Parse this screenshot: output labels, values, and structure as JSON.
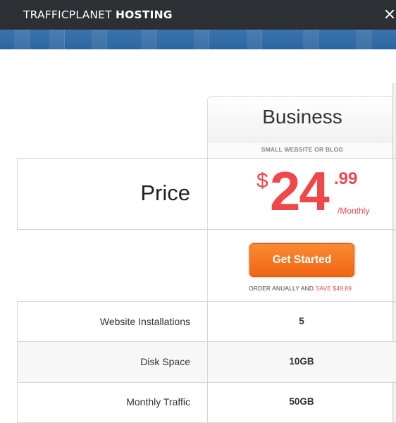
{
  "header": {
    "brand_light": "TRAFFICPLANET ",
    "brand_bold": "HOSTING"
  },
  "plan": {
    "name": "Business",
    "subtitle": "SMALL WEBSITE OR BLOG",
    "price_label": "Price",
    "currency": "$",
    "amount": "24",
    "cents": ".99",
    "period": "/Monthly",
    "cta_label": "Get Started",
    "order_note": "ORDER ANUALLY AND ",
    "save_note": "SAVE $49.89"
  },
  "features": [
    {
      "label": "Website Installations",
      "value": "5"
    },
    {
      "label": "Disk Space",
      "value": "10GB"
    },
    {
      "label": "Monthly Traffic",
      "value": "50GB"
    }
  ],
  "colors": {
    "accent_red": "#f0474b",
    "cta_orange": "#f06513",
    "header_bg": "#2c2f33",
    "hero_blue": "#3a74ad"
  }
}
